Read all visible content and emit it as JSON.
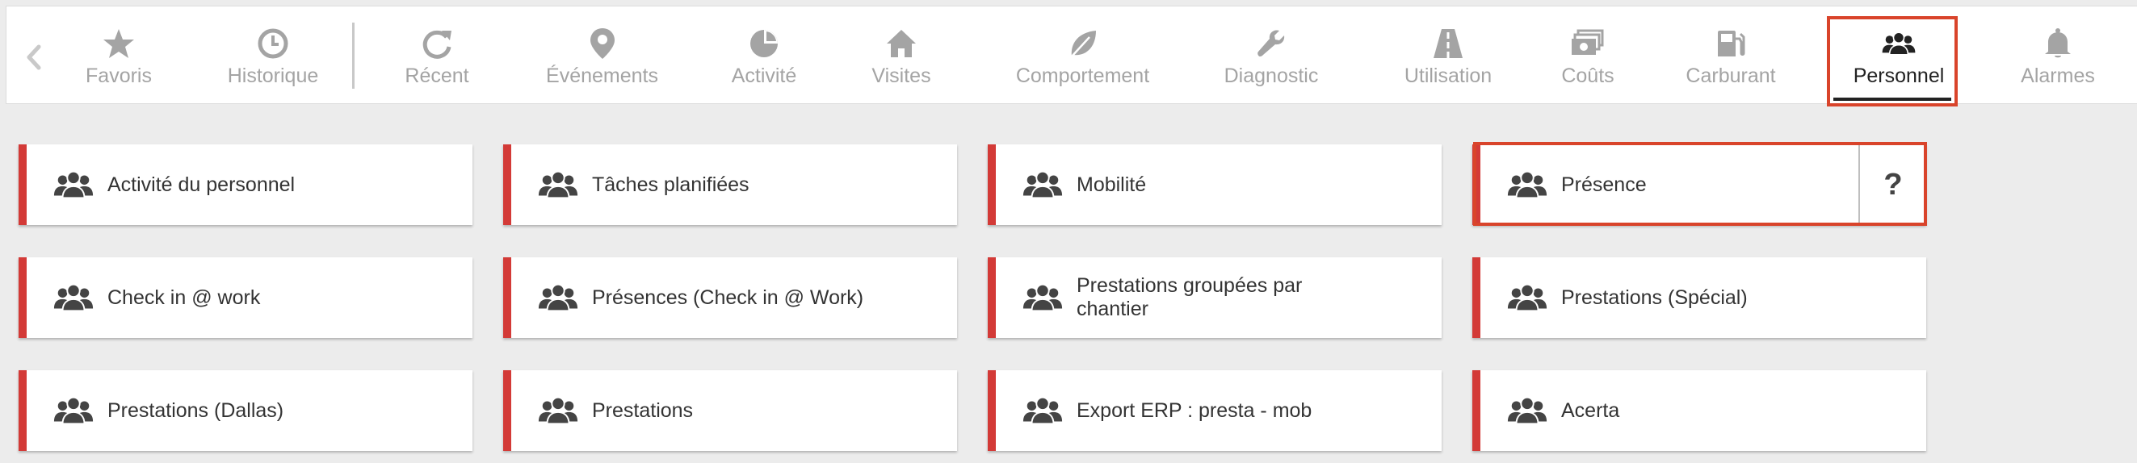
{
  "accent_color": "#d33a37",
  "highlight_color": "#d9442b",
  "nav": {
    "back_icon": "chevron-left-icon",
    "items": [
      {
        "label": "Favoris",
        "icon": "star-icon",
        "active": false
      },
      {
        "label": "Historique",
        "icon": "clock-icon",
        "active": false
      },
      {
        "label": "Récent",
        "icon": "refresh-icon",
        "active": false
      },
      {
        "label": "Événements",
        "icon": "map-pin-icon",
        "active": false
      },
      {
        "label": "Activité",
        "icon": "pie-chart-icon",
        "active": false
      },
      {
        "label": "Visites",
        "icon": "house-icon",
        "active": false
      },
      {
        "label": "Comportement",
        "icon": "leaf-icon",
        "active": false
      },
      {
        "label": "Diagnostic",
        "icon": "wrench-icon",
        "active": false
      },
      {
        "label": "Utilisation",
        "icon": "road-icon",
        "active": false
      },
      {
        "label": "Coûts",
        "icon": "banknotes-icon",
        "active": false
      },
      {
        "label": "Carburant",
        "icon": "fuel-pump-icon",
        "active": false
      },
      {
        "label": "Personnel",
        "icon": "users-icon",
        "active": true
      },
      {
        "label": "Alarmes",
        "icon": "bell-icon",
        "active": false
      }
    ]
  },
  "tiles": {
    "row1": [
      {
        "label": "Activité du personnel"
      },
      {
        "label": "Tâches planifiées"
      },
      {
        "label": "Mobilité"
      },
      {
        "label": "Présence",
        "help": "?"
      }
    ],
    "row2": [
      {
        "label": "Check in @ work"
      },
      {
        "label": "Présences (Check in @ Work)"
      },
      {
        "label": "Prestations groupées par chantier"
      },
      {
        "label": "Prestations (Spécial)"
      }
    ],
    "row3": [
      {
        "label": "Prestations (Dallas)"
      },
      {
        "label": "Prestations"
      },
      {
        "label": "Export ERP : presta - mob"
      },
      {
        "label": "Acerta"
      }
    ]
  }
}
